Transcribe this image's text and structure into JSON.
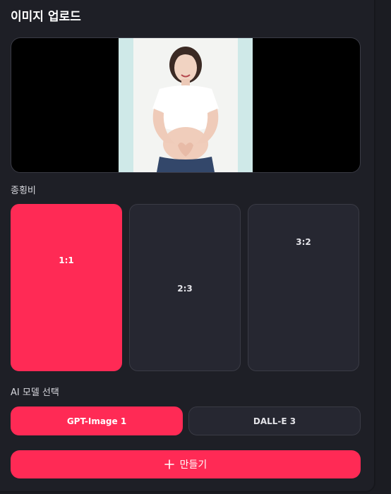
{
  "upload": {
    "title": "이미지 업로드",
    "image_description": "pregnant woman in white crop top making heart shape over belly"
  },
  "aspect_ratio": {
    "label": "종횡비",
    "options": [
      {
        "label": "1:1",
        "selected": true
      },
      {
        "label": "2:3",
        "selected": false
      },
      {
        "label": "3:2",
        "selected": false
      }
    ]
  },
  "ai_model": {
    "label": "AI 모델 선택",
    "options": [
      {
        "label": "GPT-Image 1",
        "selected": true
      },
      {
        "label": "DALL-E 3",
        "selected": false
      }
    ]
  },
  "create_button": {
    "label": "만들기",
    "icon": "plus-icon"
  },
  "colors": {
    "accent": "#ff2a55",
    "panel": "#1e1f26",
    "card": "#262731",
    "border": "#3a3b45"
  }
}
